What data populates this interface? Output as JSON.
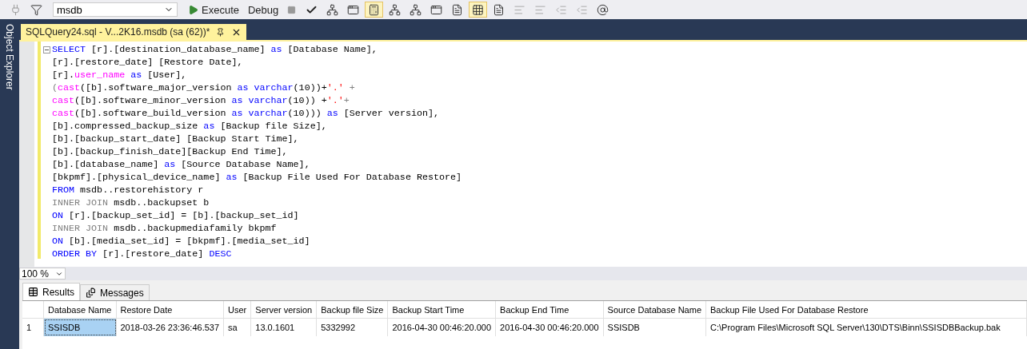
{
  "toolbar": {
    "database": "msdb",
    "icon_buttons": [
      {
        "kind": "plug",
        "selected": false
      },
      {
        "kind": "filter",
        "selected": false
      },
      {
        "kind": "execute",
        "label": "Execute",
        "selected": false
      },
      {
        "kind": "text",
        "label": "Debug",
        "selected": false
      },
      {
        "kind": "stop",
        "selected": false
      },
      {
        "kind": "check",
        "selected": false
      },
      {
        "kind": "tree",
        "selected": false
      },
      {
        "kind": "window",
        "selected": false
      },
      {
        "kind": "calc",
        "selected": true
      },
      {
        "kind": "tree",
        "selected": false
      },
      {
        "kind": "tree",
        "selected": false
      },
      {
        "kind": "window",
        "selected": false
      },
      {
        "kind": "doc",
        "selected": false
      },
      {
        "kind": "grid",
        "selected": true
      },
      {
        "kind": "doc",
        "selected": false
      },
      {
        "kind": "lines",
        "selected": false
      },
      {
        "kind": "lines",
        "selected": false
      },
      {
        "kind": "indent",
        "selected": false
      },
      {
        "kind": "indent",
        "selected": false
      },
      {
        "kind": "at",
        "selected": false
      }
    ]
  },
  "side_panel": {
    "label": "Object Explorer"
  },
  "document_tab": {
    "title": "SQLQuery24.sql - V...2K16.msdb (sa (62))*",
    "selected": true
  },
  "code_lines": [
    [
      {
        "text": "SELECT",
        "kind": "keyword"
      },
      {
        "text": " [r].[destination_database_name]",
        "kind": "plain"
      },
      {
        "text": " as",
        "kind": "keyword"
      },
      {
        "text": " [Database Name],",
        "kind": "plain"
      }
    ],
    [
      {
        "text": "[r].[restore_date] [Restore Date],",
        "kind": "plain"
      }
    ],
    [
      {
        "text": "[r].",
        "kind": "plain"
      },
      {
        "text": "user_name",
        "kind": "function"
      },
      {
        "text": " as",
        "kind": "keyword"
      },
      {
        "text": " [User],",
        "kind": "plain"
      }
    ],
    [
      {
        "text": "(",
        "kind": "operator"
      },
      {
        "text": "cast",
        "kind": "function"
      },
      {
        "text": "([b].software_major_version",
        "kind": "plain"
      },
      {
        "text": " as",
        "kind": "keyword"
      },
      {
        "text": " varchar",
        "kind": "keyword"
      },
      {
        "text": "(10))+",
        "kind": "plain"
      },
      {
        "text": "'.'",
        "kind": "string"
      },
      {
        "text": " +",
        "kind": "operator"
      }
    ],
    [
      {
        "text": "cast",
        "kind": "function"
      },
      {
        "text": "([b].software_minor_version",
        "kind": "plain"
      },
      {
        "text": " as",
        "kind": "keyword"
      },
      {
        "text": " varchar",
        "kind": "keyword"
      },
      {
        "text": "(10)) +",
        "kind": "plain"
      },
      {
        "text": "'.'",
        "kind": "string"
      },
      {
        "text": "+",
        "kind": "operator"
      }
    ],
    [
      {
        "text": "cast",
        "kind": "function"
      },
      {
        "text": "([b].software_build_version",
        "kind": "plain"
      },
      {
        "text": " as",
        "kind": "keyword"
      },
      {
        "text": " varchar",
        "kind": "keyword"
      },
      {
        "text": "(10)))",
        "kind": "plain"
      },
      {
        "text": " as",
        "kind": "keyword"
      },
      {
        "text": " [Server version],",
        "kind": "plain"
      }
    ],
    [
      {
        "text": "[b].compressed_backup_size",
        "kind": "plain"
      },
      {
        "text": " as",
        "kind": "keyword"
      },
      {
        "text": " [Backup file Size],",
        "kind": "plain"
      }
    ],
    [
      {
        "text": "[b].[backup_start_date] [Backup Start Time],",
        "kind": "plain"
      }
    ],
    [
      {
        "text": "[b].[backup_finish_date][Backup End Time],",
        "kind": "plain"
      }
    ],
    [
      {
        "text": "[b].[database_name]",
        "kind": "plain"
      },
      {
        "text": " as",
        "kind": "keyword"
      },
      {
        "text": " [Source Database Name],",
        "kind": "plain"
      }
    ],
    [
      {
        "text": "[bkpmf].[physical_device_name]",
        "kind": "plain"
      },
      {
        "text": " as",
        "kind": "keyword"
      },
      {
        "text": " [Backup File Used For Database Restore]",
        "kind": "plain"
      }
    ],
    [
      {
        "text": "FROM",
        "kind": "keyword"
      },
      {
        "text": " msdb..restorehistory r",
        "kind": "plain"
      }
    ],
    [
      {
        "text": "INNER JOIN",
        "kind": "operator"
      },
      {
        "text": " msdb..backupset b",
        "kind": "plain"
      }
    ],
    [
      {
        "text": "ON",
        "kind": "keyword"
      },
      {
        "text": " [r].[backup_set_id] = [b].[backup_set_id]",
        "kind": "plain"
      }
    ],
    [
      {
        "text": "INNER JOIN",
        "kind": "operator"
      },
      {
        "text": " msdb..backupmediafamily bkpmf",
        "kind": "plain"
      }
    ],
    [
      {
        "text": "ON",
        "kind": "keyword"
      },
      {
        "text": " [b].[media_set_id] = [bkpmf].[media_set_id]",
        "kind": "plain"
      }
    ],
    [
      {
        "text": "ORDER BY",
        "kind": "keyword"
      },
      {
        "text": " [r].[restore_date]",
        "kind": "plain"
      },
      {
        "text": " DESC",
        "kind": "keyword"
      }
    ]
  ],
  "zoom": "100 %",
  "result_tabs": [
    {
      "label": "Results",
      "kind": "grid",
      "selected": true
    },
    {
      "label": "Messages",
      "kind": "doc",
      "selected": false
    }
  ],
  "grid": {
    "columns": [
      "Database Name",
      "Restore Date",
      "User",
      "Server version",
      "Backup file Size",
      "Backup Start Time",
      "Backup End Time",
      "Source Database Name",
      "Backup File Used For Database Restore"
    ],
    "rows": [
      {
        "number": "1",
        "cells": [
          {
            "text": "SSISDB",
            "selected": true
          },
          {
            "text": "2018-03-26 23:36:46.537",
            "selected": false
          },
          {
            "text": "sa",
            "selected": false
          },
          {
            "text": "13.0.1601",
            "selected": false
          },
          {
            "text": "5332992",
            "selected": false
          },
          {
            "text": "2016-04-30 00:46:20.000",
            "selected": false
          },
          {
            "text": "2016-04-30 00:46:20.000",
            "selected": false
          },
          {
            "text": "SSISDB",
            "selected": false
          },
          {
            "text": "C:\\Program Files\\Microsoft SQL Server\\130\\DTS\\Binn\\SSISDBBackup.bak",
            "selected": false
          }
        ]
      }
    ]
  }
}
